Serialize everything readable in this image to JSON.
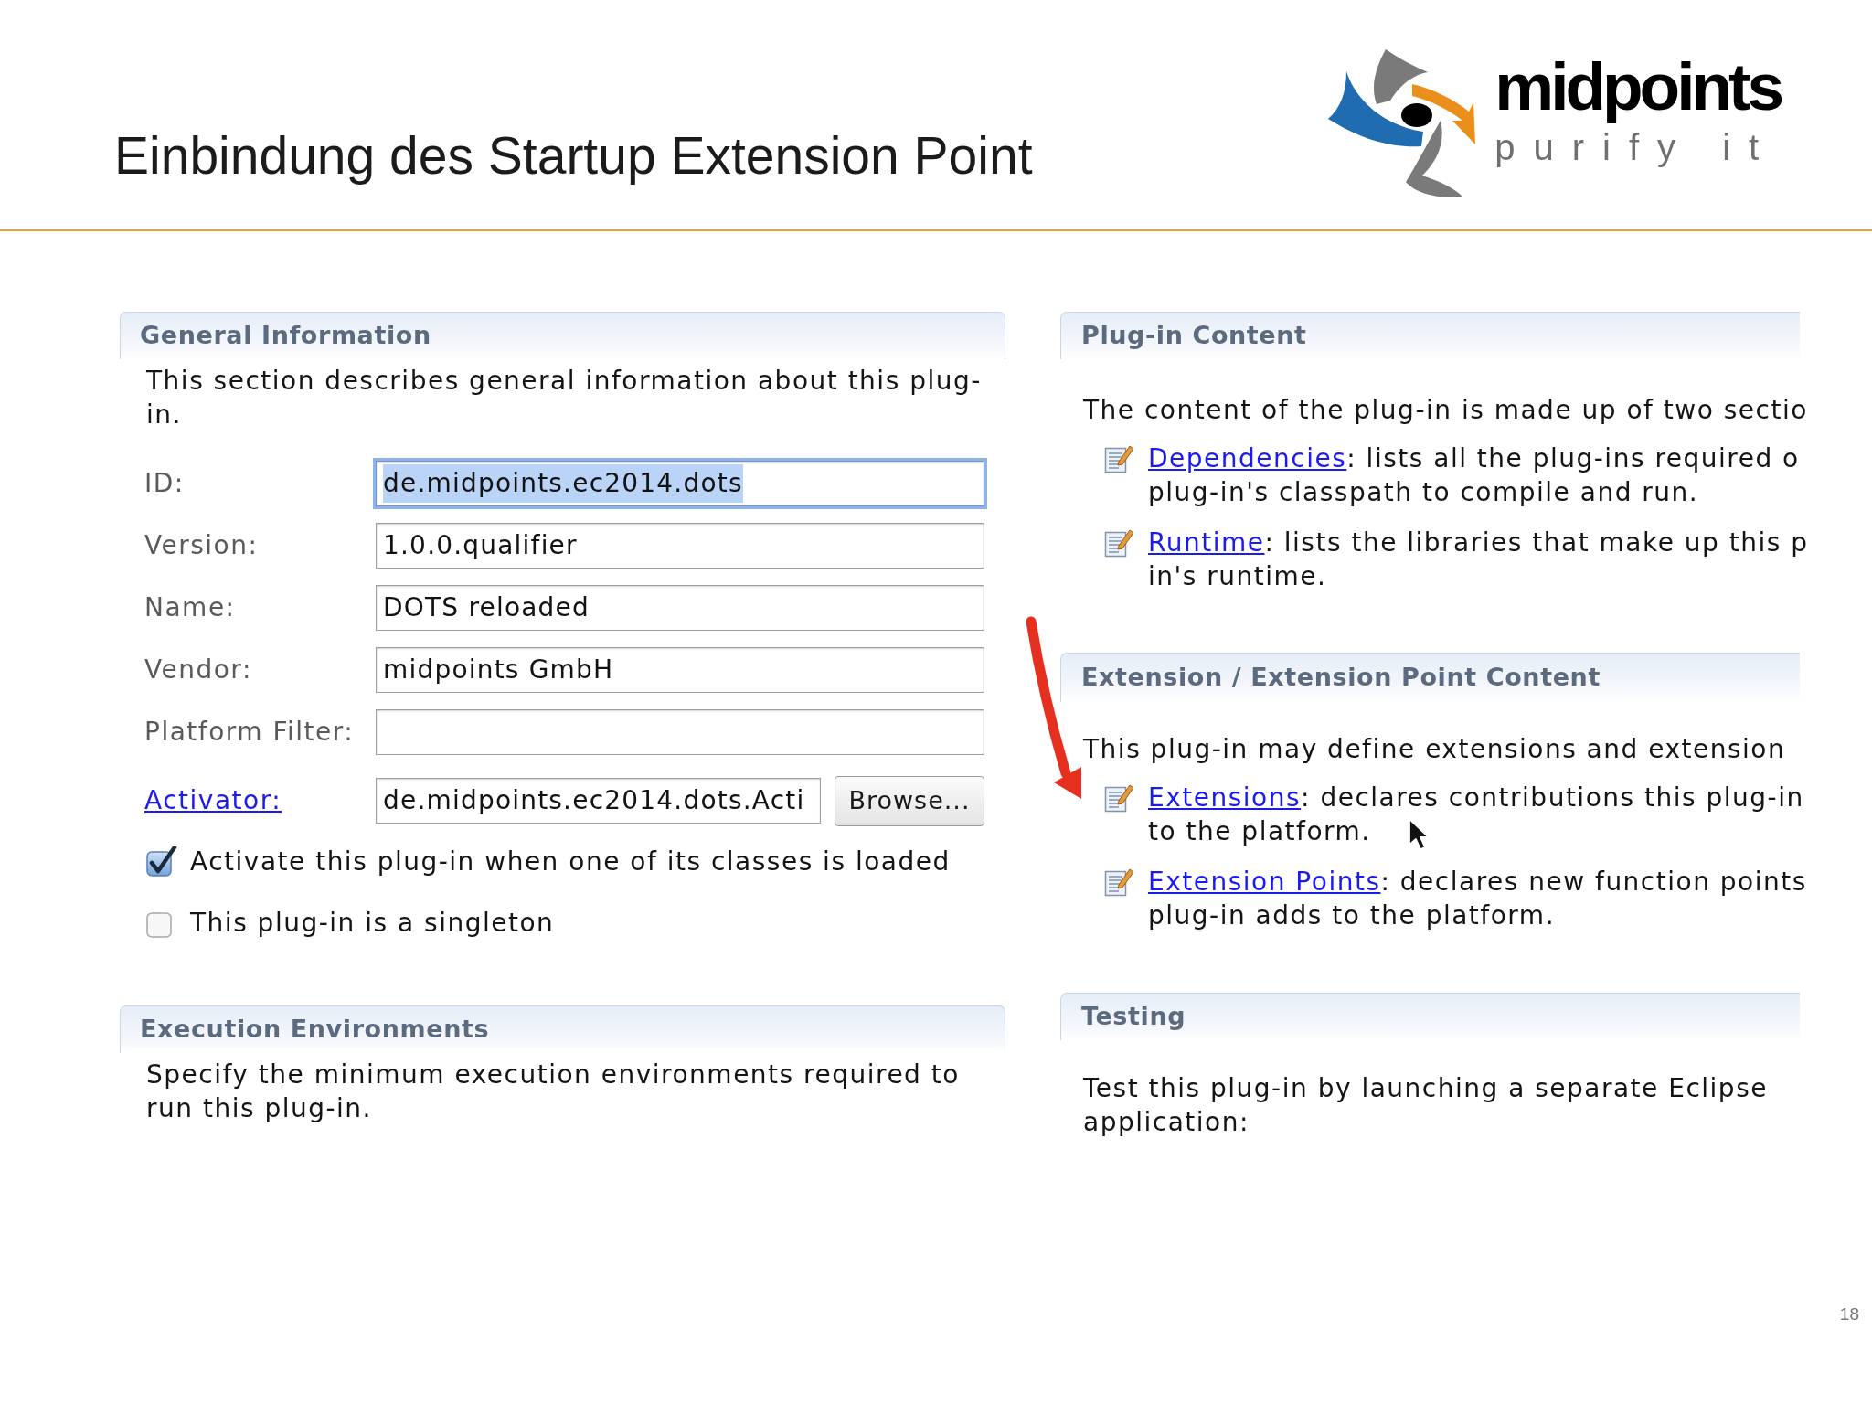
{
  "slide": {
    "title": "Einbindung des Startup Extension Point",
    "page_number": "18"
  },
  "logo": {
    "name": "midpoints",
    "tagline": "purify it"
  },
  "editor": {
    "general_information": {
      "title": "General Information",
      "description": "This section describes general information about this plug-in.",
      "fields": [
        {
          "label": "ID:",
          "kind": "text",
          "value": "de.midpoints.ec2014.dots",
          "focused": true
        },
        {
          "label": "Version:",
          "kind": "text",
          "value": "1.0.0.qualifier",
          "focused": false
        },
        {
          "label": "Name:",
          "kind": "text",
          "value": "DOTS reloaded",
          "focused": false
        },
        {
          "label": "Vendor:",
          "kind": "text",
          "value": "midpoints GmbH",
          "focused": false
        },
        {
          "label": "Platform Filter:",
          "kind": "text",
          "focused": false
        },
        {
          "label": "Activator:",
          "kind": "link",
          "value": "de.midpoints.ec2014.dots.Acti",
          "button": "Browse...",
          "focused": false
        }
      ],
      "checkboxes": [
        {
          "label": "Activate this plug-in when one of its classes is loaded",
          "checked": true
        },
        {
          "label": "This plug-in is a singleton",
          "checked": false
        }
      ]
    },
    "execution_environments": {
      "title": "Execution Environments",
      "description": "Specify the minimum execution environments required to run this plug-in."
    },
    "plugin_content": {
      "title": "Plug-in Content",
      "intro": "The content of the plug-in is made up of two sectio",
      "items": [
        {
          "link": "Dependencies",
          "line_1": ": lists all the plug-ins required o",
          "line_2": "plug-in's classpath to compile and run."
        },
        {
          "link": "Runtime",
          "line_1": ": lists the libraries that make up this p",
          "line_2": "in's runtime."
        }
      ]
    },
    "extension_content": {
      "title": "Extension / Extension Point Content",
      "intro": "This plug-in may define extensions and extension",
      "items": [
        {
          "link": "Extensions",
          "line_1": ": declares contributions this plug-in",
          "line_2": "to the platform."
        },
        {
          "link": "Extension Points",
          "line_1": ": declares new function points",
          "line_2": "plug-in adds to the platform."
        }
      ]
    },
    "testing": {
      "title": "Testing",
      "intro": "Test this plug-in by launching a separate Eclipse application:"
    }
  }
}
